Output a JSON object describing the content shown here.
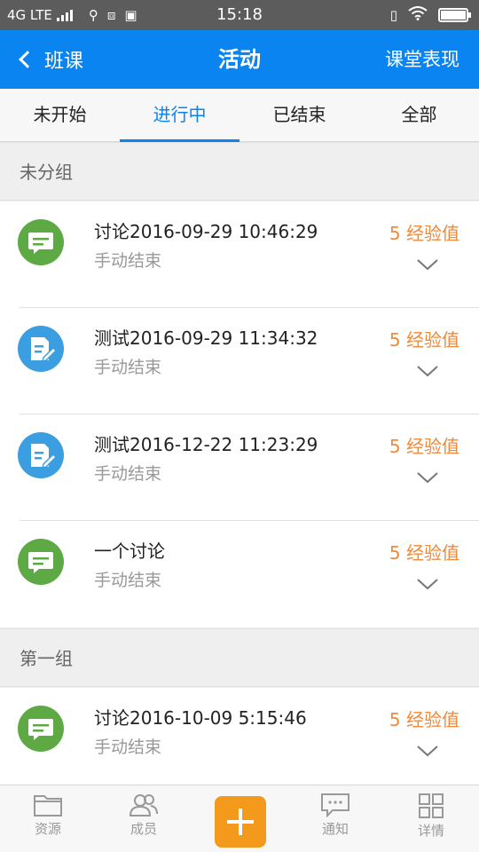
{
  "status": {
    "network": "4G LTE",
    "time": "15:18"
  },
  "header": {
    "back_label": "班课",
    "title": "活动",
    "right_label": "课堂表现"
  },
  "tabs": [
    "未开始",
    "进行中",
    "已结束",
    "全部"
  ],
  "active_tab": "进行中",
  "groups": [
    {
      "title": "未分组",
      "items": [
        {
          "type": "discussion",
          "icon": "chat-bubble-icon",
          "name": "讨论2016-09-29 10:46:29",
          "sub": "手动结束",
          "points": "5 经验值"
        },
        {
          "type": "test",
          "icon": "edit-document-icon",
          "name": "测试2016-09-29 11:34:32",
          "sub": "手动结束",
          "points": "5 经验值"
        },
        {
          "type": "test",
          "icon": "edit-document-icon",
          "name": "测试2016-12-22 11:23:29",
          "sub": "手动结束",
          "points": "5 经验值"
        },
        {
          "type": "discussion",
          "icon": "chat-bubble-icon",
          "name": "一个讨论",
          "sub": "手动结束",
          "points": "5 经验值"
        }
      ]
    },
    {
      "title": "第一组",
      "items": [
        {
          "type": "discussion",
          "icon": "chat-bubble-icon",
          "name": "讨论2016-10-09 5:15:46",
          "sub": "手动结束",
          "points": "5 经验值"
        }
      ]
    }
  ],
  "bottom_nav": {
    "resources": "资源",
    "members": "成员",
    "notices": "通知",
    "details": "详情"
  },
  "colors": {
    "primary": "#0a84f0",
    "discussion": "#5daa45",
    "test": "#3a9ee0",
    "points": "#f0893a",
    "add_button": "#f39a1c"
  }
}
